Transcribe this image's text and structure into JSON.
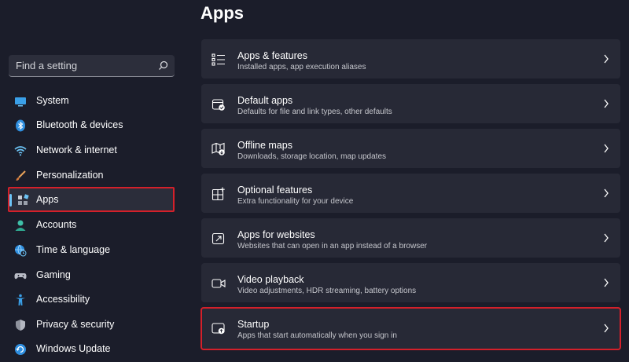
{
  "page_title": "Apps",
  "search": {
    "placeholder": "Find a setting",
    "icon": "search-icon"
  },
  "sidebar": {
    "items": [
      {
        "label": "System",
        "icon": "monitor-icon"
      },
      {
        "label": "Bluetooth & devices",
        "icon": "bluetooth-icon"
      },
      {
        "label": "Network & internet",
        "icon": "wifi-icon"
      },
      {
        "label": "Personalization",
        "icon": "brush-icon"
      },
      {
        "label": "Apps",
        "icon": "apps-icon",
        "selected": true
      },
      {
        "label": "Accounts",
        "icon": "person-icon"
      },
      {
        "label": "Time & language",
        "icon": "globe-clock-icon"
      },
      {
        "label": "Gaming",
        "icon": "gamepad-icon"
      },
      {
        "label": "Accessibility",
        "icon": "accessibility-icon"
      },
      {
        "label": "Privacy & security",
        "icon": "shield-icon"
      },
      {
        "label": "Windows Update",
        "icon": "update-icon"
      }
    ]
  },
  "cards": [
    {
      "title": "Apps & features",
      "subtitle": "Installed apps, app execution aliases",
      "icon": "list-icon"
    },
    {
      "title": "Default apps",
      "subtitle": "Defaults for file and link types, other defaults",
      "icon": "default-apps-icon"
    },
    {
      "title": "Offline maps",
      "subtitle": "Downloads, storage location, map updates",
      "icon": "map-icon"
    },
    {
      "title": "Optional features",
      "subtitle": "Extra functionality for your device",
      "icon": "grid-plus-icon"
    },
    {
      "title": "Apps for websites",
      "subtitle": "Websites that can open in an app instead of a browser",
      "icon": "open-link-icon"
    },
    {
      "title": "Video playback",
      "subtitle": "Video adjustments, HDR streaming, battery options",
      "icon": "video-icon"
    },
    {
      "title": "Startup",
      "subtitle": "Apps that start automatically when you sign in",
      "icon": "startup-icon",
      "highlighted": true
    }
  ],
  "colors": {
    "background": "#1b1d2a",
    "card": "#272936",
    "accent": "#6cc3f5",
    "highlight_border": "#d4202a"
  }
}
